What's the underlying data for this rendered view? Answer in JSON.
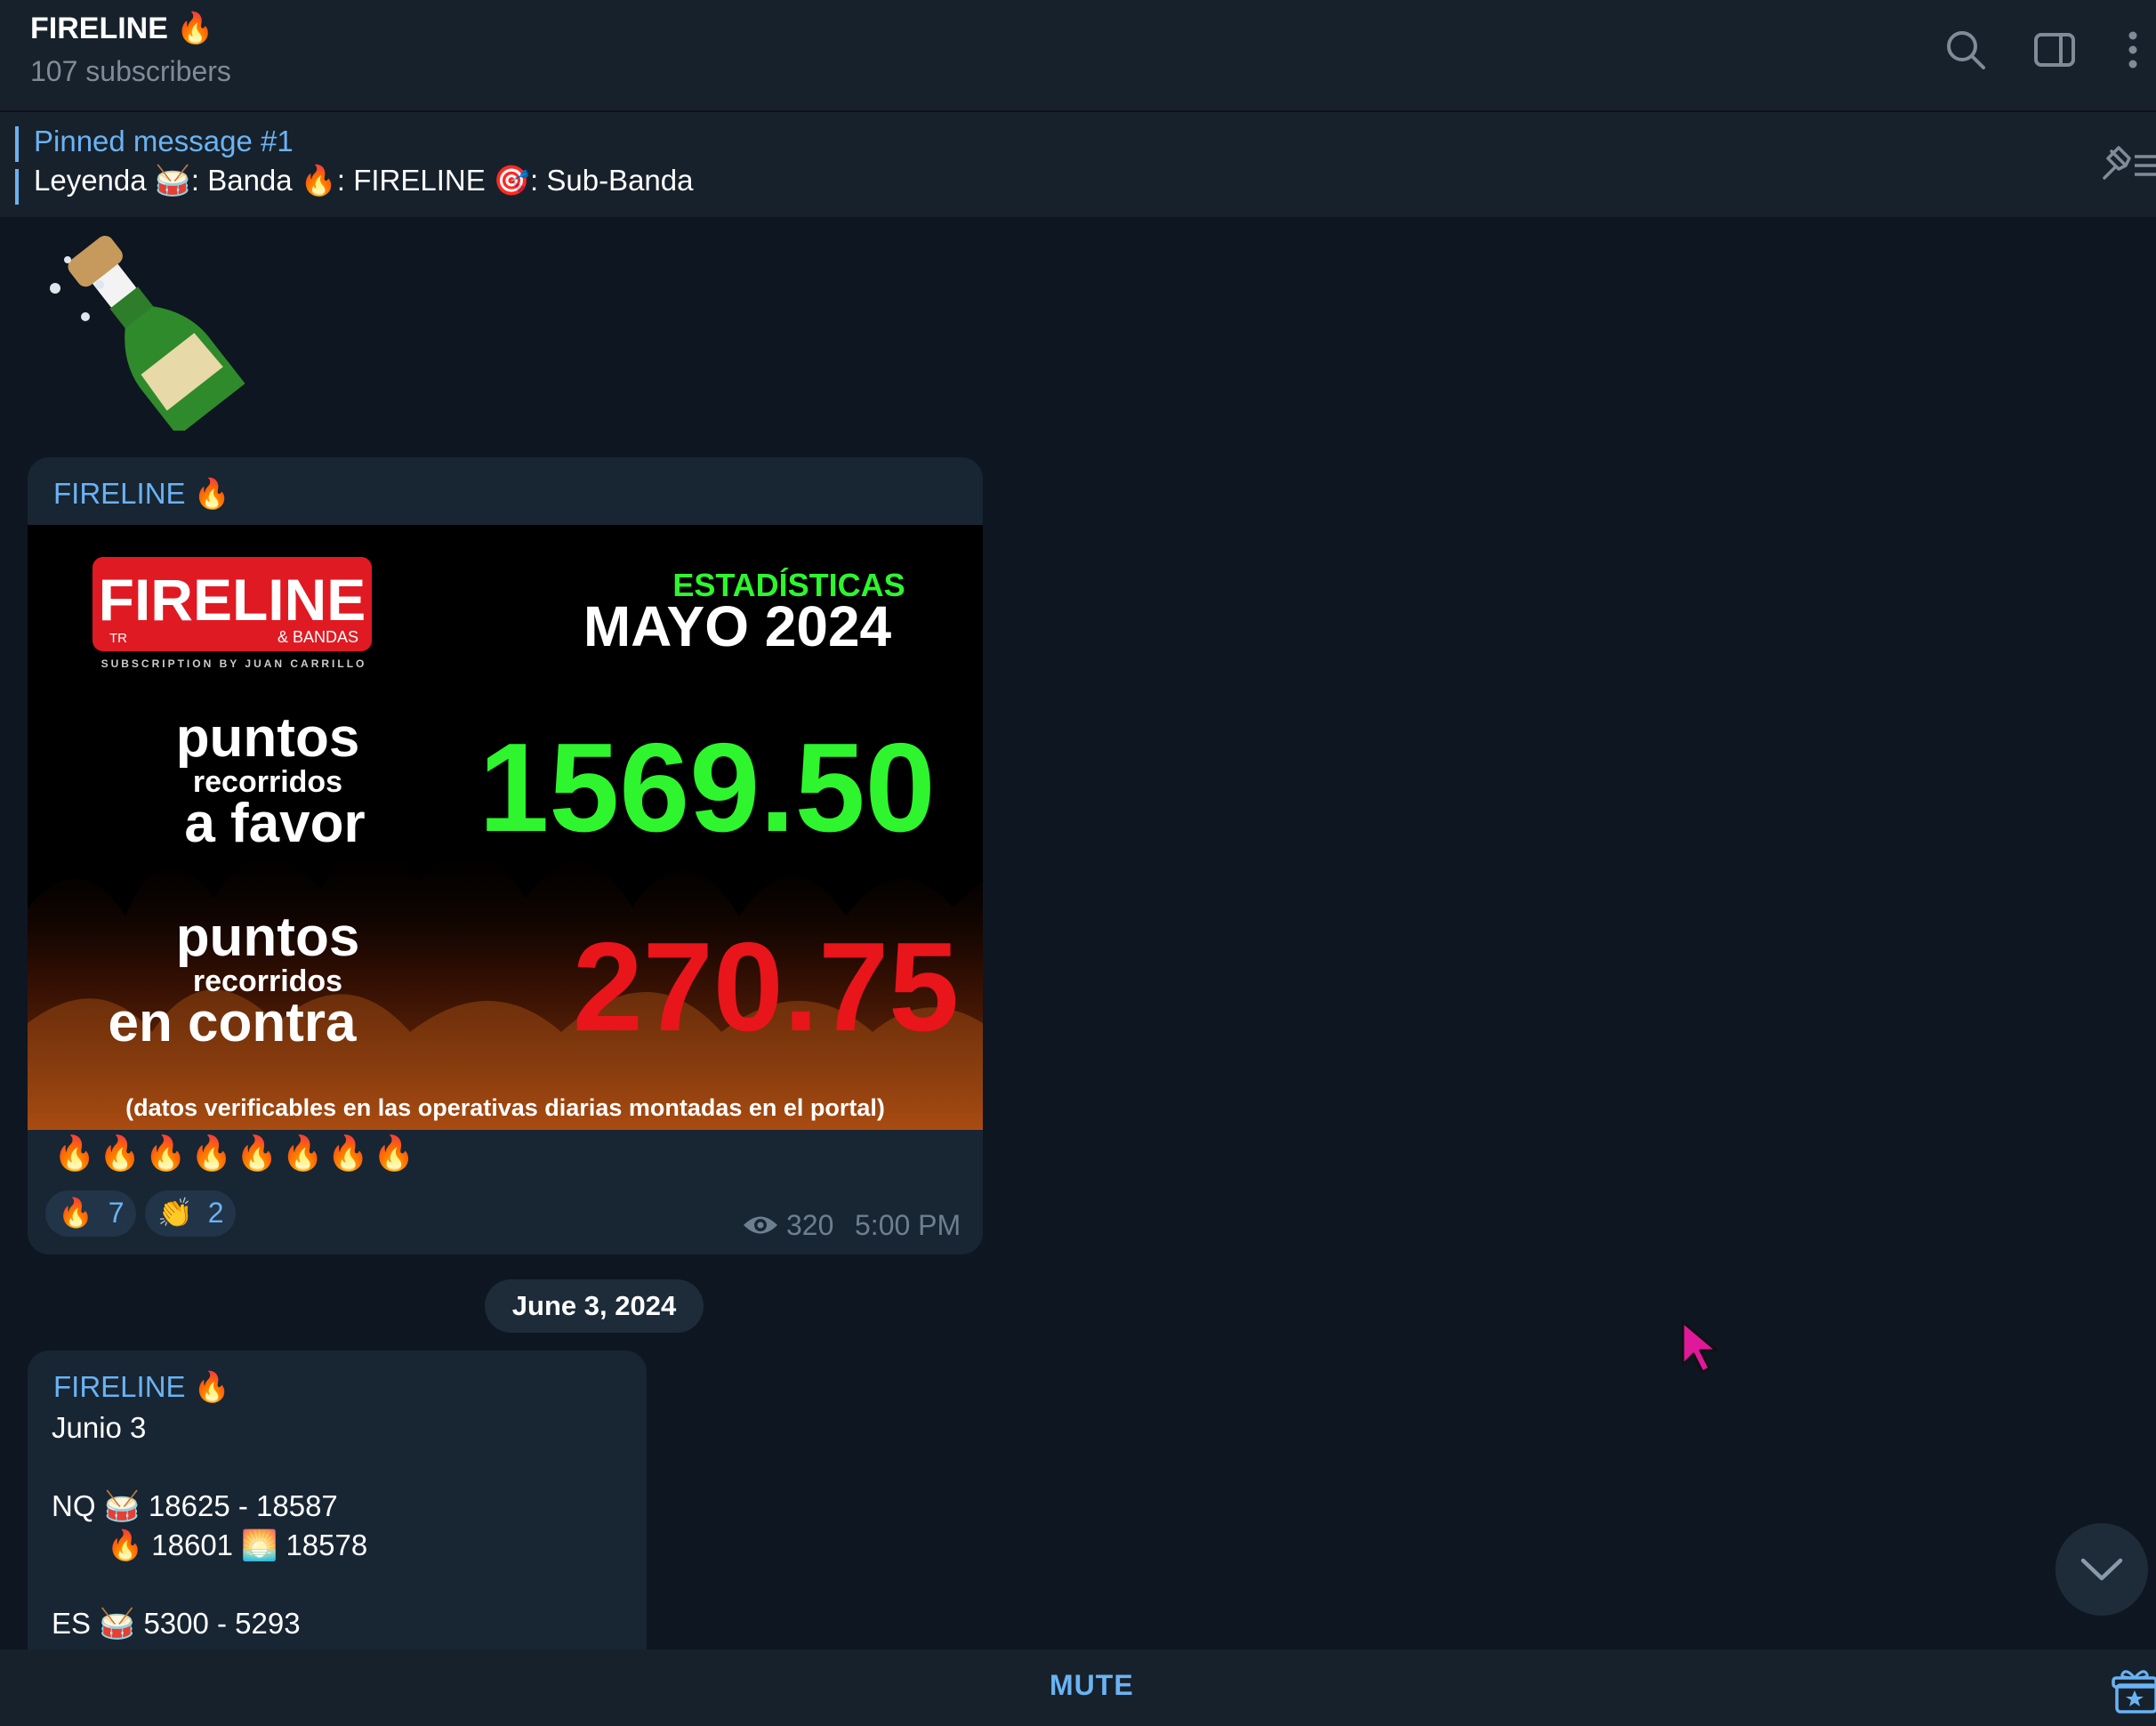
{
  "header": {
    "title": "FIRELINE 🔥",
    "subtitle": "107 subscribers"
  },
  "pinned": {
    "title": "Pinned message #1",
    "text": "Leyenda 🥁: Banda  🔥: FIRELINE  🎯: Sub-Banda"
  },
  "message1": {
    "sender": "FIRELINE 🔥",
    "image": {
      "logo_main": "FIRELINE",
      "logo_tr": "TR",
      "logo_sub": "& BANDAS",
      "logo_tagline": "SUBSCRIPTION BY JUAN CARRILLO",
      "stats_label": "ESTADÍSTICAS",
      "month": "MAYO 2024",
      "favor_line1": "puntos",
      "favor_line2": "recorridos",
      "favor_line3": "a favor",
      "favor_value": "1569.50",
      "contra_line1": "puntos",
      "contra_line2": "recorridos",
      "contra_line3": "en contra",
      "contra_value": "270.75",
      "footnote": "(datos verificables en las operativas diarias montadas en el portal)"
    },
    "text": "🔥🔥🔥🔥🔥🔥🔥🔥",
    "reactions": [
      {
        "emoji": "🔥",
        "count": "7"
      },
      {
        "emoji": "👏",
        "count": "2"
      }
    ],
    "views": "320",
    "time": "5:00 PM"
  },
  "date_separator": "June 3, 2024",
  "message2": {
    "sender": "FIRELINE 🔥",
    "lines": [
      "Junio 3",
      "NQ 🥁 18625 - 18587",
      "🔥 18601 🌅 18578",
      "ES 🥁 5300 - 5293"
    ]
  },
  "bottom": {
    "mute_label": "MUTE"
  },
  "colors": {
    "background": "#0e1621",
    "panel": "#17212b",
    "bubble": "#182533",
    "accent": "#6ab3f3",
    "favor_green": "#2ef52e",
    "contra_red": "#e8151b",
    "logo_red": "#e01a22"
  },
  "icons": [
    "search-icon",
    "sidebar-toggle-icon",
    "more-vertical-icon",
    "pin-list-icon",
    "eye-icon",
    "chevron-down-icon",
    "gift-icon",
    "mouse-cursor"
  ]
}
